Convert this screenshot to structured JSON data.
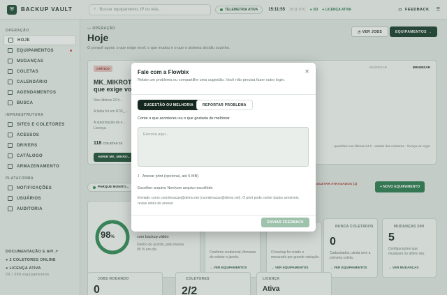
{
  "app": {
    "brand": "BACKUP VAULT"
  },
  "topbar": {
    "search_placeholder": "Buscar equipamento, IP ou tela...",
    "telemetry": "TELEMETRIA ATIVA",
    "clock": "15:11:55",
    "clock_secondary": "15:11 UTC",
    "status_count": "3/3",
    "license": "LICENÇA ATIVA",
    "feedback": "FEEDBACK"
  },
  "sidebar": {
    "sections": [
      {
        "title": "OPERAÇÃO",
        "items": [
          {
            "label": "HOJE",
            "active": true
          },
          {
            "label": "EQUIPAMENTOS",
            "badge": true
          },
          {
            "label": "MUDANÇAS"
          },
          {
            "label": "COLETAS"
          },
          {
            "label": "CALENDÁRIO"
          },
          {
            "label": "AGENDAMENTOS"
          },
          {
            "label": "BUSCA"
          }
        ]
      },
      {
        "title": "INFRAESTRUTURA",
        "items": [
          {
            "label": "SITES E COLETORES"
          },
          {
            "label": "ACESSOS"
          },
          {
            "label": "DRIVERS"
          },
          {
            "label": "CATÁLOGO"
          },
          {
            "label": "ARMAZENAMENTO"
          }
        ]
      },
      {
        "title": "PLATAFORMA",
        "items": [
          {
            "label": "NOTIFICAÇÕES"
          },
          {
            "label": "USUÁRIOS"
          },
          {
            "label": "AUDITORIA"
          }
        ]
      }
    ],
    "footer": {
      "docs": "DOCUMENTAÇÃO E API",
      "collectors": "2 COLETORES ONLINE",
      "license": "LICENÇA ATIVA",
      "license_sub": "29 / 390 equipamentos"
    }
  },
  "main": {
    "breadcrumb": "— OPERAÇÃO",
    "title": "Hoje",
    "lead": "O porquê agora: o que exige você, o que mudou e o que o sistema decidiu sozinho.",
    "btn_view_jobs": "VER JOBS",
    "btn_equipment": "EQUIPAMENTOS",
    "alert": {
      "tag": "CRÍTICO",
      "title": "MK_MIKROTIK_...",
      "title2": "que exige você ...",
      "line1": "Nos últimos 24 h...",
      "line2": "A falha foi em RTR_...",
      "line3": "A autorização de e...",
      "line4": "Licença.",
      "meta": "118",
      "meta_sub": "COLETAS 24",
      "action": "ABRIR MK_MIKRO...",
      "dismiss": "SILENCIAR",
      "minimize": "MINIMIZAR"
    },
    "note_right": "...questões nas últimas 24 h · estado dos coletores · licença em vigor",
    "park_tag": "PARQUE MONITO...",
    "late_collection": "COLETAR ATRASADOS (1)",
    "new_equipment": "+ NOVO EQUIPAMENTO",
    "gauge": {
      "value": "98",
      "unit": "%",
      "progress": 98,
      "note1": "com backup válido",
      "note2": "Dentro do acordo, pelo menos",
      "note3": "95 % em dia"
    },
    "cards": [
      {
        "label": "",
        "text": "Confirme credencial, firmware do coletor e janela.",
        "link": "VER EQUIPAMENTOS"
      },
      {
        "label": "",
        "text": "O backup foi criado e mesurado por grande variação.",
        "link": "VER EQUIPAMENTOS"
      },
      {
        "label": "NUNCA COLETADOS",
        "num": "0",
        "text": "Cadastrados, ainda sem a primeira coleta.",
        "link": "VER EQUIPAMENTOS"
      },
      {
        "label": "MUDANÇAS 24H",
        "num": "5",
        "text": "Configurações que mudaram no último dia.",
        "link": "VER MUDANÇAS"
      }
    ],
    "bottom_cards": [
      {
        "label": "JOBS RODANDO",
        "num": "0"
      },
      {
        "label": "COLETORES",
        "num": "2/2"
      },
      {
        "label": "LICENÇA",
        "num": "Ativa"
      }
    ]
  },
  "modal": {
    "title": "Fale com a Flowbix",
    "description": "Relate um problema ou compartilhe uma sugestão. Você não precisa fazer outro login.",
    "tab_suggestion": "SUGESTÃO OU MELHORIA",
    "tab_problem": "REPORTAR PROBLEMA",
    "question": "Conte o que aconteceu ou o que gostaria de melhorar",
    "textarea_placeholder": "Escreva aqui...",
    "attach_label": "Anexar print (opcional, até 5 MB)",
    "file_status": "Escolher arquivo  Nenhum arquivo escolhido",
    "note": "Enviado como coordenacao@demo.net (coordenacao@demo.net). O print pode conter dados sensíveis; revise antes de anexar.",
    "send": "ENVIAR FEEDBACK"
  }
}
